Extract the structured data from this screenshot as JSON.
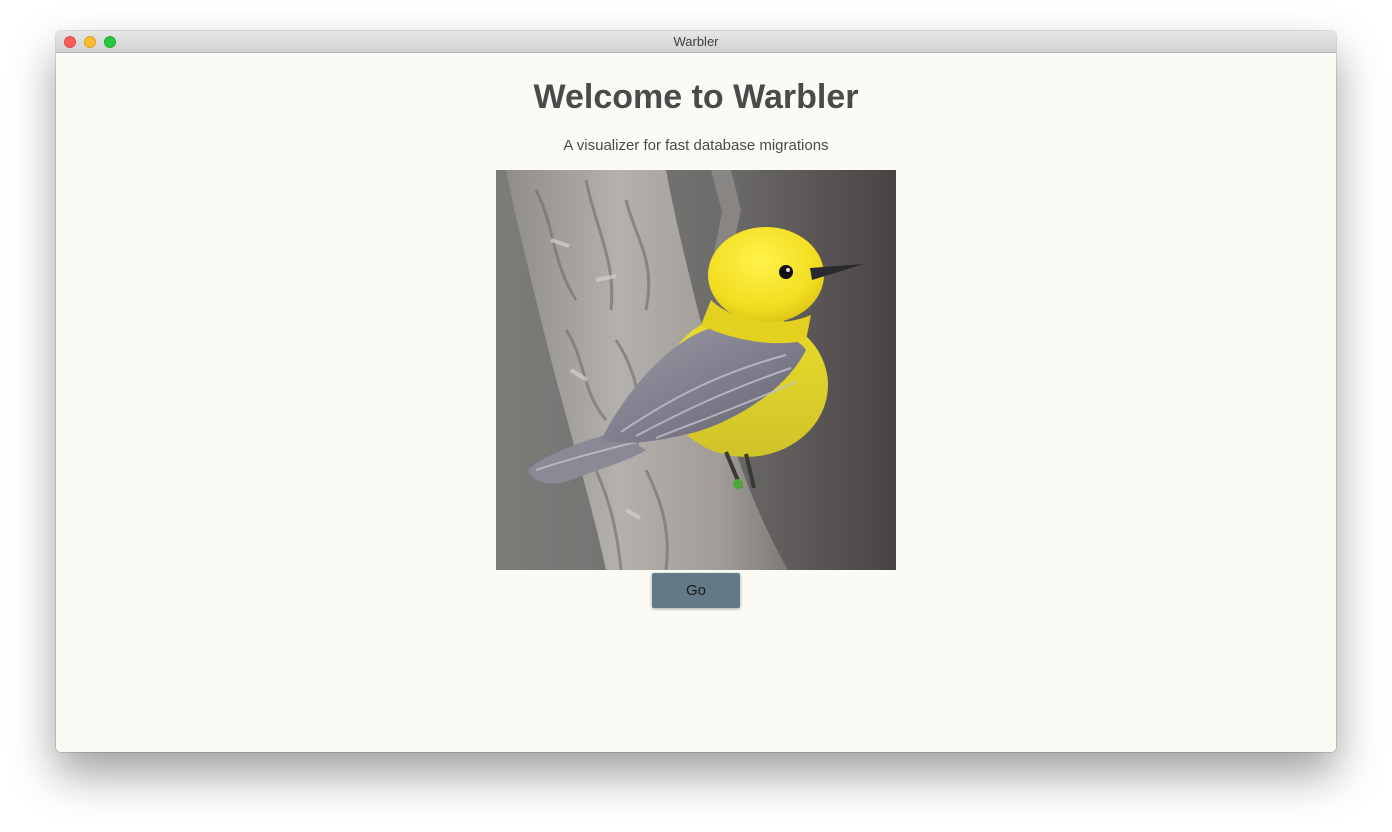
{
  "window": {
    "title": "Warbler"
  },
  "main": {
    "heading": "Welcome to Warbler",
    "subheading": "A visualizer for fast database migrations",
    "image": {
      "subject": "yellow warbler bird perched on tree trunk"
    },
    "go_button_label": "Go"
  },
  "colors": {
    "page_background": "#fbfbf6",
    "button_background": "#627987",
    "heading_text": "#4a4a4a"
  }
}
